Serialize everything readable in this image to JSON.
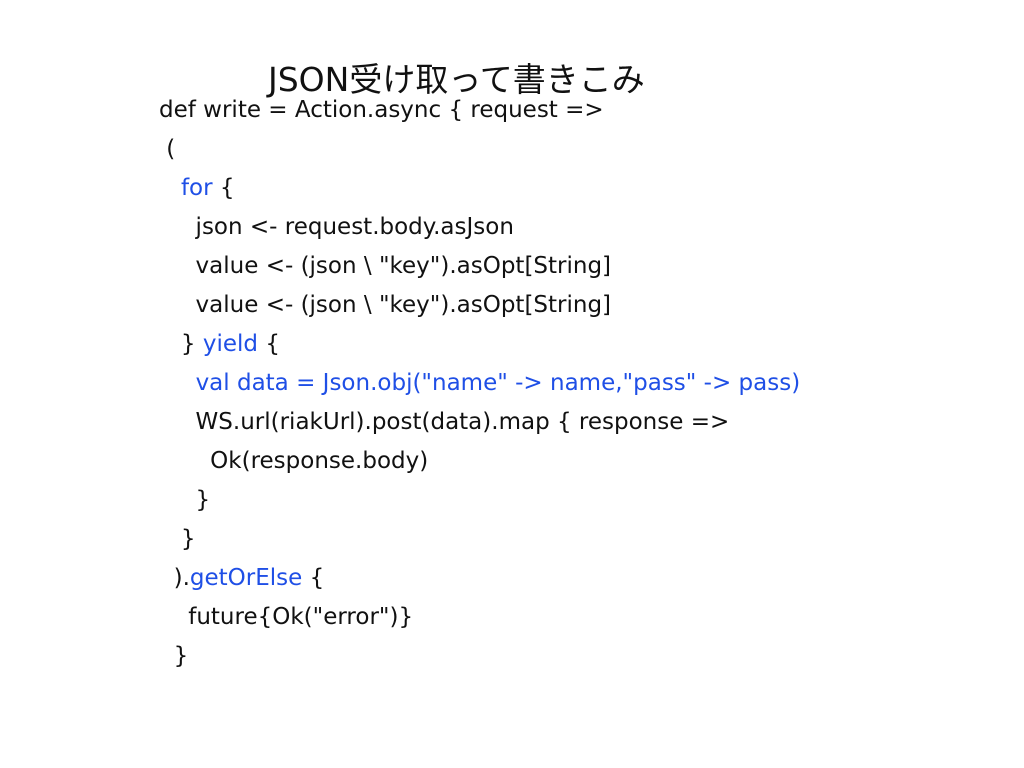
{
  "slide": {
    "title": "JSON受け取って書きこみ",
    "colors": {
      "text": "#111111",
      "keyword": "#1f4fe6",
      "background": "#ffffff"
    },
    "code_lines": [
      {
        "segments": [
          {
            "text": "def write = Action.async { request =>",
            "kind": "plain"
          }
        ]
      },
      {
        "segments": [
          {
            "text": " (",
            "kind": "plain"
          }
        ]
      },
      {
        "segments": [
          {
            "text": "   ",
            "kind": "plain"
          },
          {
            "text": "for",
            "kind": "keyword"
          },
          {
            "text": " {",
            "kind": "plain"
          }
        ]
      },
      {
        "segments": [
          {
            "text": "     json <- request.body.asJson",
            "kind": "plain"
          }
        ]
      },
      {
        "segments": [
          {
            "text": "     value <- (json \\ \"key\").asOpt[String]",
            "kind": "plain"
          }
        ]
      },
      {
        "segments": [
          {
            "text": "     value <- (json \\ \"key\").asOpt[String]",
            "kind": "plain"
          }
        ]
      },
      {
        "segments": [
          {
            "text": "   } ",
            "kind": "plain"
          },
          {
            "text": "yield",
            "kind": "keyword"
          },
          {
            "text": " {",
            "kind": "plain"
          }
        ]
      },
      {
        "segments": [
          {
            "text": "     ",
            "kind": "plain"
          },
          {
            "text": "val data = Json.obj(\"name\" -> name,\"pass\" -> pass)",
            "kind": "keyword"
          }
        ]
      },
      {
        "segments": [
          {
            "text": "     WS.url(riakUrl).post(data).map { response =>",
            "kind": "plain"
          }
        ]
      },
      {
        "segments": [
          {
            "text": "       Ok(response.body)",
            "kind": "plain"
          }
        ]
      },
      {
        "segments": [
          {
            "text": "     }",
            "kind": "plain"
          }
        ]
      },
      {
        "segments": [
          {
            "text": "   }",
            "kind": "plain"
          }
        ]
      },
      {
        "segments": [
          {
            "text": "  ).",
            "kind": "plain"
          },
          {
            "text": "getOrElse",
            "kind": "keyword"
          },
          {
            "text": " {",
            "kind": "plain"
          }
        ]
      },
      {
        "segments": [
          {
            "text": "    future{Ok(\"error\")}",
            "kind": "plain"
          }
        ]
      },
      {
        "segments": [
          {
            "text": "  }",
            "kind": "plain"
          }
        ]
      }
    ]
  }
}
